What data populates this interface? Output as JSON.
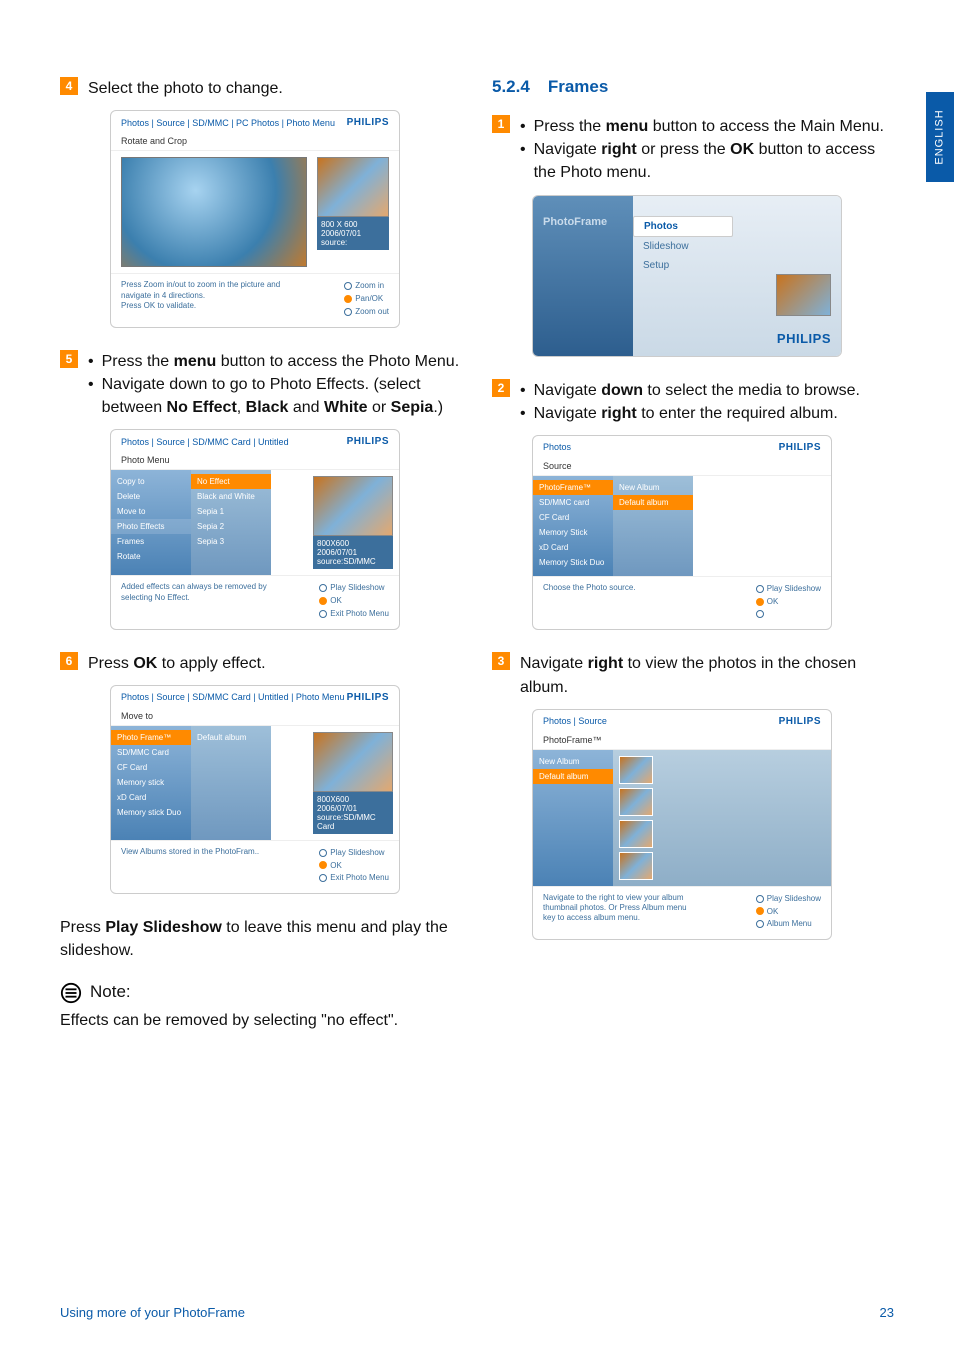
{
  "lang_tab": "ENGLISH",
  "left": {
    "step4": {
      "num": "4",
      "text": "Select the photo to change."
    },
    "ss1": {
      "breadcrumb": "Photos | Source | SD/MMC | PC Photos | Photo Menu",
      "brand": "PHILIPS",
      "sub": "Rotate and Crop",
      "thumb_line1": "800 X 600",
      "thumb_line2": "2006/07/01",
      "thumb_line3": "source:",
      "foot_left_l1": "Press Zoom in/out to zoom in the picture and",
      "foot_left_l2": "navigate in 4 directions.",
      "foot_left_l3": "Press OK to validate.",
      "fr1": "Zoom in",
      "fr2": "Pan/OK",
      "fr3": "Zoom out"
    },
    "step5": {
      "num": "5",
      "b1_pre": "Press the ",
      "b1_bold": "menu",
      "b1_post": " button to access the Photo Menu.",
      "b2_pre": "Navigate  down to go to Photo Effects. (select between ",
      "b2_b1": "No Effect",
      "b2_m1": ", ",
      "b2_b2": "Black",
      "b2_m2": " and ",
      "b2_b3": "White",
      "b2_m3": " or ",
      "b2_b4": "Sepia",
      "b2_m4": ".)"
    },
    "ss2": {
      "breadcrumb": "Photos | Source | SD/MMC Card | Untitled",
      "brand": "PHILIPS",
      "sub": "Photo Menu",
      "l1": "Copy to",
      "l2": "Delete",
      "l3": "Move to",
      "l4": "Photo Effects",
      "l5": "Frames",
      "l6": "Rotate",
      "r1": "No Effect",
      "r2": "Black and White",
      "r3": "Sepia 1",
      "r4": "Sepia 2",
      "r5": "Sepia 3",
      "t1": "800X600",
      "t2": "2006/07/01",
      "t3": "source:SD/MMC",
      "foot_left_l1": "Added effects can always be removed by",
      "foot_left_l2": "selecting No Effect.",
      "fr1": "Play Slideshow",
      "fr2": "OK",
      "fr3": "Exit Photo Menu"
    },
    "step6": {
      "num": "6",
      "pre": "Press ",
      "bold": "OK",
      "post": " to apply effect."
    },
    "ss3": {
      "breadcrumb": "Photos | Source | SD/MMC Card | Untitled | Photo Menu",
      "brand": "PHILIPS",
      "sub": "Move to",
      "l1": "Photo Frame™",
      "l2": "SD/MMC Card",
      "l3": "CF Card",
      "l4": "Memory stick",
      "l5": "xD Card",
      "l6": "Memory stick Duo",
      "r1": "Default album",
      "t1": "800X600",
      "t2": "2006/07/01",
      "t3": "source:SD/MMC Card",
      "foot_left": "View Albums stored in the PhotoFram..",
      "fr1": "Play Slideshow",
      "fr2": "OK",
      "fr3": "Exit Photo Menu"
    },
    "after_ss3_pre": "Press ",
    "after_ss3_bold": "Play Slideshow",
    "after_ss3_post": " to leave this menu and play the slideshow.",
    "note_label": "Note:",
    "note_text": "Effects can be removed by selecting \"no effect\"."
  },
  "right": {
    "heading_num": "5.2.4",
    "heading_text": "Frames",
    "step1": {
      "num": "1",
      "b1_pre": "Press the ",
      "b1_bold": "menu",
      "b1_post": " button to access the Main Menu.",
      "b2_pre": "Navigate ",
      "b2_b1": "right",
      "b2_m1": " or press the ",
      "b2_b2": "OK",
      "b2_post": " button to access the Photo menu."
    },
    "ss1": {
      "title": "PhotoFrame",
      "m1": "Photos",
      "m2": "Slideshow",
      "m3": "Setup",
      "brand": "PHILIPS"
    },
    "step2": {
      "num": "2",
      "b1_pre": "Navigate ",
      "b1_bold": "down",
      "b1_post": " to select the media to browse.",
      "b2_pre": "Navigate ",
      "b2_bold": "right",
      "b2_post": " to enter the required album."
    },
    "ss2": {
      "head": "Photos",
      "brand": "PHILIPS",
      "sub": "Source",
      "l1": "PhotoFrame™",
      "l2": "SD/MMC card",
      "l3": "CF Card",
      "l4": "Memory Stick",
      "l5": "xD Card",
      "l6": "Memory Stick Duo",
      "r1": "New Album",
      "r2": "Default album",
      "foot_left": "Choose the Photo source.",
      "fr1": "Play Slideshow",
      "fr2": "OK"
    },
    "step3": {
      "num": "3",
      "pre": "Navigate ",
      "bold": "right",
      "post": " to view the photos in the chosen album."
    },
    "ss3": {
      "head": "Photos | Source",
      "brand": "PHILIPS",
      "sub": "PhotoFrame™",
      "l1": "New Album",
      "l2": "Default album",
      "foot_l1": "Navigate to the right to view your album",
      "foot_l2": "thumbnail photos. Or Press Album menu",
      "foot_l3": "key to access album menu.",
      "fr1": "Play Slideshow",
      "fr2": "OK",
      "fr3": "Album Menu"
    }
  },
  "footer": {
    "left": "Using more of your PhotoFrame",
    "right": "23"
  }
}
